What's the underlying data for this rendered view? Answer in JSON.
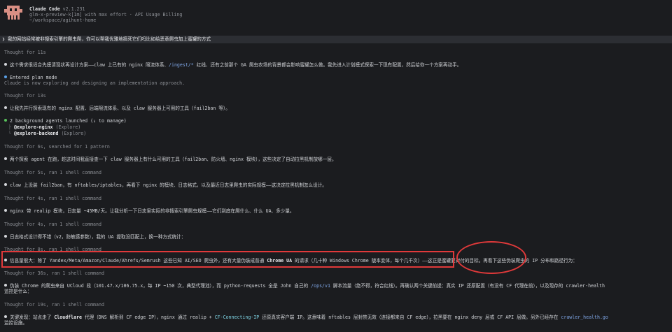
{
  "header": {
    "title": "Claude Code",
    "version": "v2.1.231",
    "model_line": "glm-x-preview-k[1m] with max effort · API Usage Billing",
    "path": "~/workspace/agihunt-home"
  },
  "prompt": "❯ 我的网站经常被非搜索引擎的爬虫爬，你可以帮我优雅地搞死它们吗比如给恶意爬虫加上蜜罐的方式",
  "lines": {
    "l1": "Thought for 11s",
    "l2a": "这个需求很适合先摸清现状再设计方案——claw 上已有的 nginx 限流体系、",
    "l2b": "/ingest/*",
    "l2c": " 红线、还有之前那个 GA 爬虫农场的背景都会影响蜜罐怎么做。我先进入计划模式探索一下现有配置，然后给你一个方案再动手。",
    "l3a": "Entered plan mode",
    "l3b": "Claude is now exploring and designing an implementation approach.",
    "l4": "Thought for 13s",
    "l5": "让我先并行探索现有的 nginx 配置、后端限流体系、以及 claw 服务器上可用的工具（fail2ban 等）。",
    "l6": "2 background agents launched (↓ to manage)",
    "l6a": "@explore-nginx",
    "l6a2": " (Explore)",
    "l6b": "@explore-backend",
    "l6b2": " (Explore)",
    "l7": "Thought for 6s, searched for 1 pattern",
    "l8": "两个探索 agent 在跑，趁这时间我直接查一下 claw 服务器上有什么可用的工具（fail2ban、防火墙、nginx 模块），这些决定了自动拉黑机制放哪一层。",
    "l9": "Thought for 5s, ran 1 shell command",
    "l10": "claw 上没装 fail2ban，有 nftables/iptables，再看下 nginx 的模块、日志格式，以及最近日志里爬虫的实际规模——这决定拉黑机制怎么设计。",
    "l11": "Thought for 4s, ran 1 shell command",
    "l12": "nginx 带 realip 模块，日志量 ~45MB/天。让我分析一下日志里实际的非搜索引擎爬虫规模——它们到底在爬什么、什么 UA、多少量。",
    "l13": "Thought for 4s, ran 1 shell command",
    "l14": "日志格式设计得不错（v2，防敏感参数），我的 UA 提取没匹配上，换一种方式统计：",
    "l15": "Thought for 8s, ran 1 shell command",
    "l16a": "信息量很大：除了 Yandex/Meta/Amazon/Claude/Ahrefs/Semrush 这些已知 AI/SEO 爬虫外，还有大量伪装成普通 ",
    "l16b": "Chrome UA",
    "l16c": " 的请求（几十种 Windows Chrome 版本变体，每个几千次）",
    "l16d": "——这正是蜜罐要对付的目标。再看下这些伪装爬虫的 IP 分布和路径行为：",
    "l17": "Thought for 36s, ran 1 shell command",
    "l18a": "伪装 Chrome 的爬虫来自 UCloud 段（101.47.x/106.75.x，每 IP ~150 次，典型代理池），而 python-requests 全是 John 自己的 ",
    "l18b": "/ops/v1",
    "l18c": " 脚本流量（绝不得，符合红线）。再确认两个关键前提：真实 IP 还原配置（有没有 CF 代理在前），以及现存的 crawler-health",
    "l18d": "监控是什么：",
    "l19": "Thought for 19s, ran 1 shell command",
    "l20a": "关键发现：站点走了 ",
    "l20b": "Cloudflare",
    "l20c": " 代理（DNS 解析到 CF edge IP），nginx 通过 realip + ",
    "l20d": "CF-Connecting-IP",
    "l20e": " 还原真实客户端 IP。这意味着 nftables 层封禁无效（连接都来自 CF edge），拉黑要在 nginx deny 层或 CF API 层做。另外已经存在 ",
    "l20f": "crawler_health.go",
    "l20g": "监控设施。"
  },
  "colors": {
    "accent_red": "#e0393a",
    "bullet_blue": "#5aa0e6",
    "bullet_green": "#58c15b"
  },
  "icons": [
    "claude-pixel-logo",
    "bullet-dot-icon",
    "tree-branch-icon"
  ]
}
